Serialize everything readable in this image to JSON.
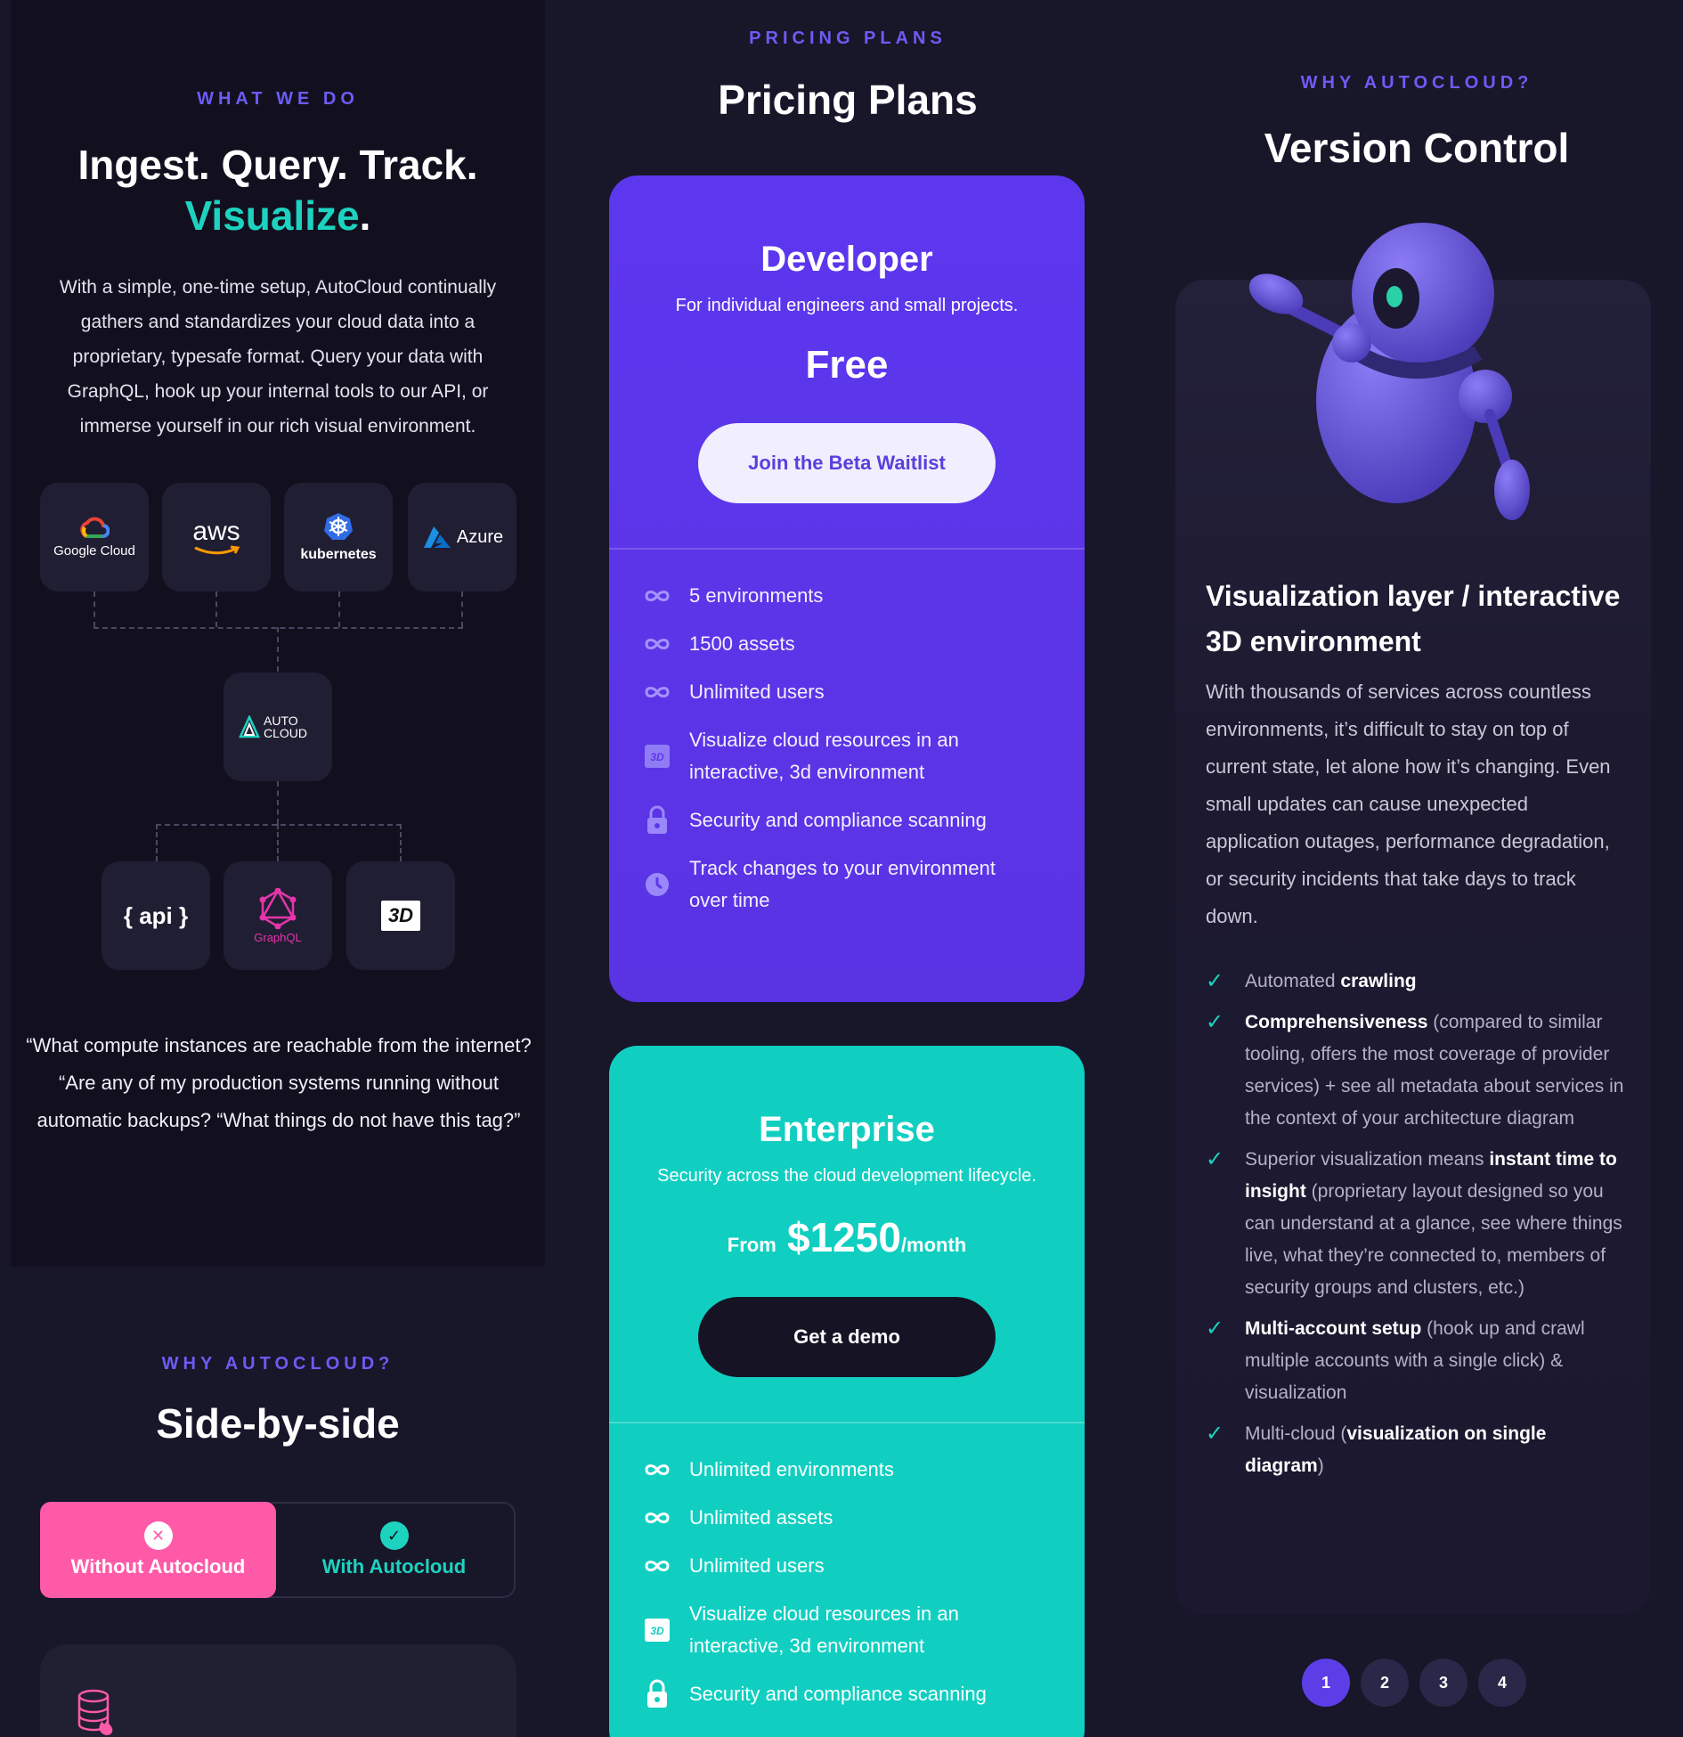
{
  "left": {
    "eyebrow": "WHAT WE DO",
    "title_line1": "Ingest. Query. Track.",
    "title_highlight": "Visualize",
    "title_dot": ".",
    "intro": "With a simple, one-time setup, AutoCloud continually gathers and standardizes your cloud data into a proprietary, typesafe format. Query your data with GraphQL, hook up your internal tools to our API, or immerse yourself in our rich visual environment.",
    "sources": [
      "Google Cloud",
      "aws",
      "kubernetes",
      "Azure"
    ],
    "hub": "AUTO CLOUD",
    "outputs": [
      "{ api }",
      "GraphQL",
      "3D"
    ],
    "quote": "“What compute instances are reachable from the internet? “Are any of my production systems running without automatic backups? “What things do not have this tag?”"
  },
  "side": {
    "eyebrow": "WHY AUTOCLOUD?",
    "title": "Side-by-side",
    "toggle_without": "Without Autocloud",
    "toggle_with": "With Autocloud"
  },
  "pricing": {
    "eyebrow": "PRICING PLANS",
    "title": "Pricing Plans",
    "developer": {
      "name": "Developer",
      "desc": "For individual engineers and small projects.",
      "price": "Free",
      "cta": "Join the Beta Waitlist",
      "features": [
        "5 environments",
        "1500 assets",
        "Unlimited users",
        "Visualize cloud resources in an interactive, 3d environment",
        "Security and compliance scanning",
        "Track changes to your environment over time"
      ]
    },
    "enterprise": {
      "name": "Enterprise",
      "desc": "Security across the cloud development lifecycle.",
      "price_prefix": "From",
      "price": "$1250",
      "price_suffix": "/month",
      "cta": "Get a demo",
      "features": [
        "Unlimited environments",
        "Unlimited assets",
        "Unlimited users",
        "Visualize cloud resources in an interactive, 3d environment",
        "Security and compliance scanning"
      ]
    }
  },
  "why": {
    "eyebrow": "WHY AUTOCLOUD?",
    "title": "Version Control",
    "card_title": "Visualization layer / interactive 3D environment",
    "body": "With thousands of services across countless environments, it’s difficult to stay on top of current state, let alone how it’s changing. Even small updates can cause unexpected application outages, performance degradation, or security incidents that take days to track down.",
    "checks": [
      {
        "pre": "Automated ",
        "bold": "crawling",
        "post": ""
      },
      {
        "pre": "",
        "bold": "Comprehensiveness",
        "post": " (compared to similar tooling, offers the most coverage of provider services) + see all metadata about services in the context of your architecture diagram"
      },
      {
        "pre": "Superior visualization means ",
        "bold": "instant time to insight",
        "post": " (proprietary layout designed so you can understand at a glance, see where things live, what they’re connected to, members of security groups and clusters, etc.)"
      },
      {
        "pre": "",
        "bold": "Multi-account setup",
        "post": " (hook up and crawl multiple accounts with a single click) & visualization"
      },
      {
        "pre": "Multi-cloud (",
        "bold": "visualization on single diagram",
        "post": ")"
      }
    ],
    "pages": [
      "1",
      "2",
      "3",
      "4"
    ]
  },
  "colors": {
    "accent": "#6c5cf5",
    "teal": "#1dd3c0",
    "developer_bg": "#5d37ee",
    "enterprise_bg": "#10cfc1",
    "pink": "#ff5aa8"
  }
}
